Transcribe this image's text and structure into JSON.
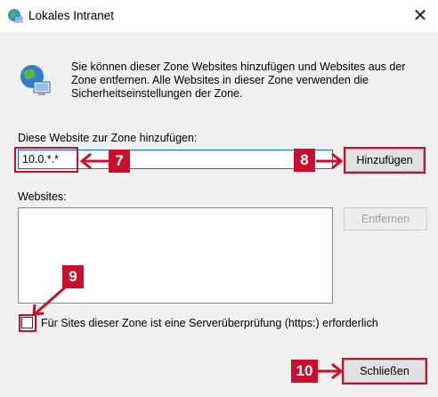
{
  "window": {
    "title": "Lokales Intranet",
    "close_glyph": "✕",
    "icon": "intranet-zone-icon"
  },
  "description": "Sie können dieser Zone Websites hinzufügen und Websites aus der Zone entfernen. Alle Websites in dieser Zone verwenden die Sicherheitseinstellungen der Zone.",
  "add_site": {
    "label": "Diese Website zur Zone hinzufügen:",
    "value": "10.0.*.*",
    "button": "Hinzufügen"
  },
  "websites": {
    "label": "Websites:",
    "items": [],
    "remove_button": "Entfernen"
  },
  "https_check": {
    "label": "Für Sites dieser Zone ist eine Serverüberprüfung (https:) erforderlich",
    "checked": false
  },
  "close_button": "Schließen",
  "annotations": {
    "badge_7": "7",
    "badge_8": "8",
    "badge_9": "9",
    "badge_10": "10",
    "color": "#c8102e"
  }
}
